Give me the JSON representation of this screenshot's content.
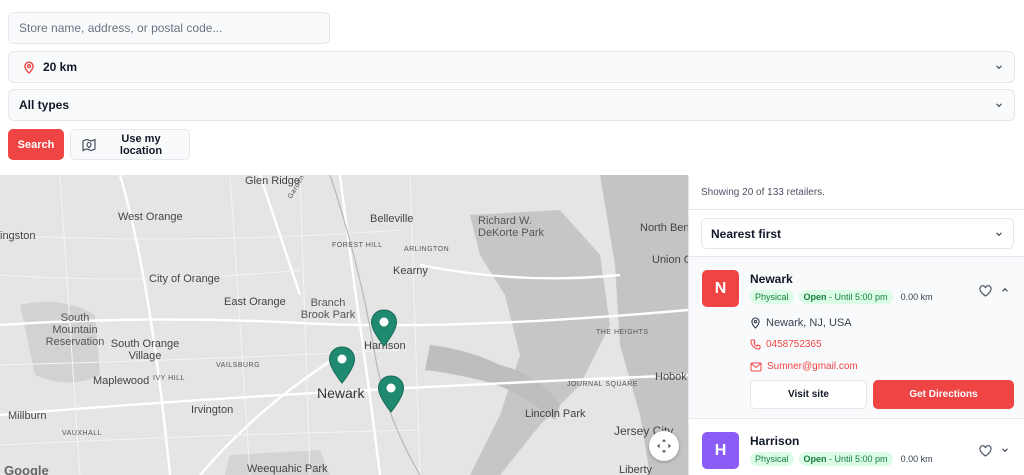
{
  "search": {
    "placeholder": "Store name, address, or postal code...",
    "value": ""
  },
  "filters": {
    "radius": "20 km",
    "type": "All types"
  },
  "buttons": {
    "search": "Search",
    "use_location": "Use my location"
  },
  "map": {
    "labels": {
      "glen_ridge": "Glen Ridge",
      "garden_state": "Garden State",
      "west_orange": "West Orange",
      "belleville": "Belleville",
      "richard_dekorte": "Richard W. DeKorte Park",
      "north_bergen": "North Ben",
      "livingston": "ingston",
      "forest_hill": "FOREST HILL",
      "arlington": "ARLINGTON",
      "union_city": "Union Ci",
      "kearny": "Kearny",
      "city_of_orange": "City of Orange",
      "east_orange": "East Orange",
      "branch_brook": "Branch Brook Park",
      "south_mountain": "South Mountain Reservation",
      "harrison": "Harrison",
      "the_heights": "THE HEIGHTS",
      "south_orange": "South Orange Village",
      "vailsburg": "VAILSBURG",
      "maplewood": "Maplewood",
      "ivy_hill": "IVY HILL",
      "newark": "Newark",
      "journal_square": "JOURNAL SQUARE",
      "hoboken": "Hobok",
      "millburn": "Millburn",
      "irvington": "Irvington",
      "lincoln_park": "Lincoln Park",
      "vauxhall": "VAUXHALL",
      "jersey_city": "Jersey City",
      "weequahic": "Weequahic Park",
      "liberty": "Liberty",
      "google": "Google"
    }
  },
  "results": {
    "showing": "Showing 20 of 133 retailers.",
    "sort": "Nearest first"
  },
  "retailers": [
    {
      "initial": "N",
      "name": "Newark",
      "type": "Physical",
      "open_label": "Open",
      "hours": " - Until 5:00 pm",
      "distance": "0.00 km",
      "address": "Newark, NJ, USA",
      "phone": "0458752365",
      "email": "Sumner@gmail.com",
      "visit_label": "Visit site",
      "directions_label": "Get Directions"
    },
    {
      "initial": "H",
      "name": "Harrison",
      "type": "Physical",
      "open_label": "Open",
      "hours": " - Until 5:00 pm",
      "distance": "0.00 km"
    }
  ],
  "colors": {
    "accent": "#ef4444",
    "marker": "#1f8a70",
    "badge_bg": "#dcfce7",
    "badge_text": "#15803d",
    "avatar_h": "#8b5cf6"
  }
}
